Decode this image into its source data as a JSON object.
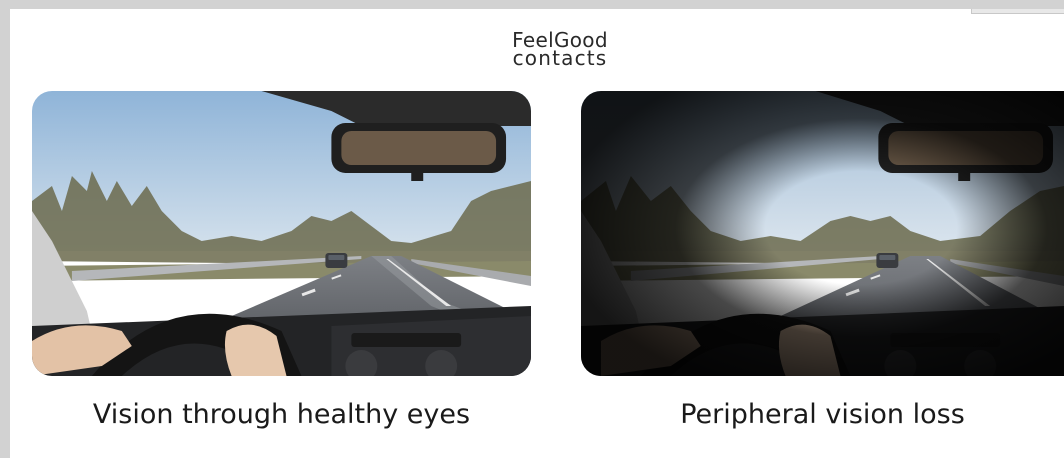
{
  "brand": {
    "line1": "FeelGood",
    "line2": "contacts"
  },
  "panels": [
    {
      "caption": "Vision through healthy eyes",
      "effect": "none"
    },
    {
      "caption": "Peripheral vision loss",
      "effect": "peripheral-darkening"
    }
  ],
  "colors": {
    "page_background": "#ffffff",
    "frame_background": "#d2d2d2",
    "caption_text": "#1a1a1a",
    "logo_text": "#2a2a2a"
  }
}
